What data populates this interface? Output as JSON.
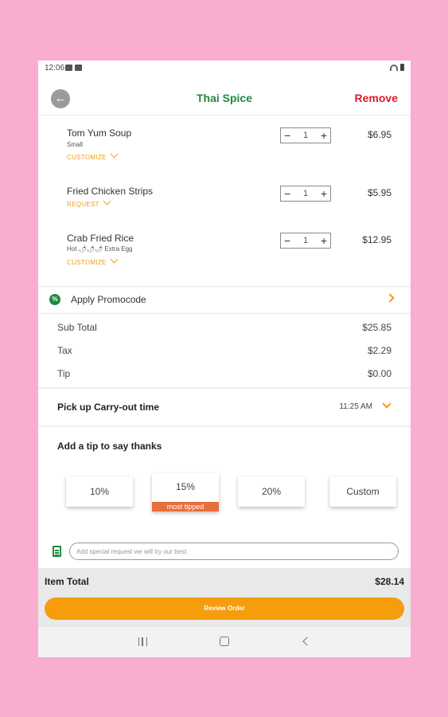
{
  "status_bar": {
    "time": "12:06"
  },
  "header": {
    "title": "Thai Spice",
    "remove_label": "Remove",
    "back_icon": "back-arrow-icon"
  },
  "items": [
    {
      "name": "Tom Yum Soup",
      "detail": "Small",
      "action": "CUSTOMIZE",
      "qty": "1",
      "price": "$6.95"
    },
    {
      "name": "Fried Chicken Strips",
      "detail": "",
      "action": "REQUEST",
      "qty": "1",
      "price": "$5.95"
    },
    {
      "name": "Crab Fried Rice",
      "detail": "Hot 🌶🌶🌶 Extra Egg",
      "action": "CUSTOMIZE",
      "qty": "1",
      "price": "$12.95"
    }
  ],
  "stepper": {
    "minus": "−",
    "plus": "+"
  },
  "promo": {
    "label": "Apply Promocode"
  },
  "summary": {
    "subtotal_label": "Sub Total",
    "subtotal": "$25.85",
    "tax_label": "Tax",
    "tax": "$2.29",
    "tip_label": "Tip",
    "tip": "$0.00"
  },
  "pickup": {
    "label": "Pick up Carry-out time",
    "time": "11:25 AM"
  },
  "tip_section": {
    "label": "Add a tip to say thanks",
    "options": [
      "10%",
      "15%",
      "20%",
      "Custom"
    ],
    "selected_tag": "most tipped"
  },
  "special_request": {
    "placeholder": "Add special request we will try our best"
  },
  "footer": {
    "total_label": "Item Total",
    "total": "$28.14",
    "review_label": "Review Order"
  },
  "colors": {
    "brand_green": "#1f8a3e",
    "remove_red": "#d91f26",
    "accent_orange": "#f59d0d",
    "tag_orange": "#e86e3b",
    "background_pink": "#f9adcf"
  }
}
